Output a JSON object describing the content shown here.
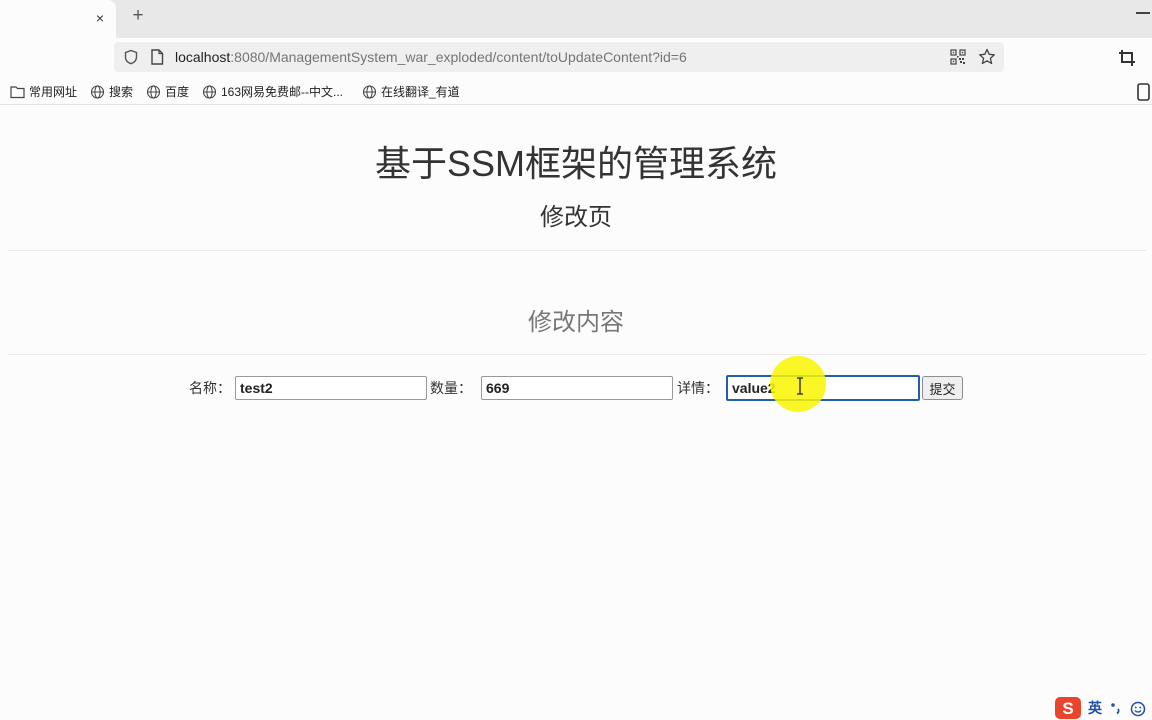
{
  "browser": {
    "new_tab_glyph": "+",
    "tab_close_glyph": "×",
    "url_host": "localhost",
    "url_rest": ":8080/ManagementSystem_war_exploded/content/toUpdateContent?id=6",
    "bookmarks": [
      {
        "icon": "folder-icon",
        "label": "常用网址"
      },
      {
        "icon": "globe-icon",
        "label": "搜索"
      },
      {
        "icon": "globe-icon",
        "label": "百度"
      },
      {
        "icon": "globe-icon",
        "label": "163网易免费邮--中文..."
      },
      {
        "icon": "globe-icon",
        "label": "在线翻译_有道"
      }
    ]
  },
  "page": {
    "title": "基于SSM框架的管理系统",
    "subtitle": "修改页",
    "section_title": "修改内容"
  },
  "form": {
    "name_label": "名称：",
    "name_value": "test2",
    "quantity_label": "数量：",
    "quantity_value": "669",
    "detail_label": "详情：",
    "detail_value": "value2",
    "submit_label": "提交"
  },
  "ime": {
    "lang": "英"
  },
  "colors": {
    "focus_border": "#1f5fb0",
    "cursor_highlight": "#faf500",
    "ime_logo": "#e8452c"
  }
}
